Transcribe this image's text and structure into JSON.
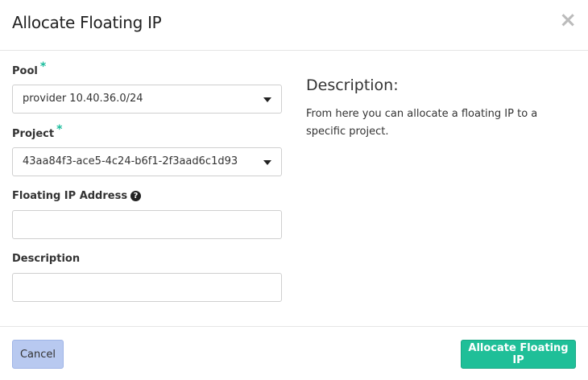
{
  "dialog": {
    "title": "Allocate Floating IP",
    "close_glyph": "×"
  },
  "form": {
    "pool": {
      "label": "Pool",
      "required_mark": "*",
      "value": "provider 10.40.36.0/24"
    },
    "project": {
      "label": "Project",
      "required_mark": "*",
      "value": "43aa84f3-ace5-4c24-b6f1-2f3aad6c1d93"
    },
    "floating_ip": {
      "label": "Floating IP Address",
      "help_icon": "question-circle-icon",
      "value": ""
    },
    "description": {
      "label": "Description",
      "value": ""
    }
  },
  "help": {
    "title": "Description:",
    "text": "From here you can allocate a floating IP to a specific project."
  },
  "footer": {
    "cancel_label": "Cancel",
    "submit_label": "Allocate Floating IP"
  },
  "colors": {
    "accent": "#1fbf98",
    "cancel_bg": "#b8c9f0",
    "required": "#1abc9c"
  }
}
